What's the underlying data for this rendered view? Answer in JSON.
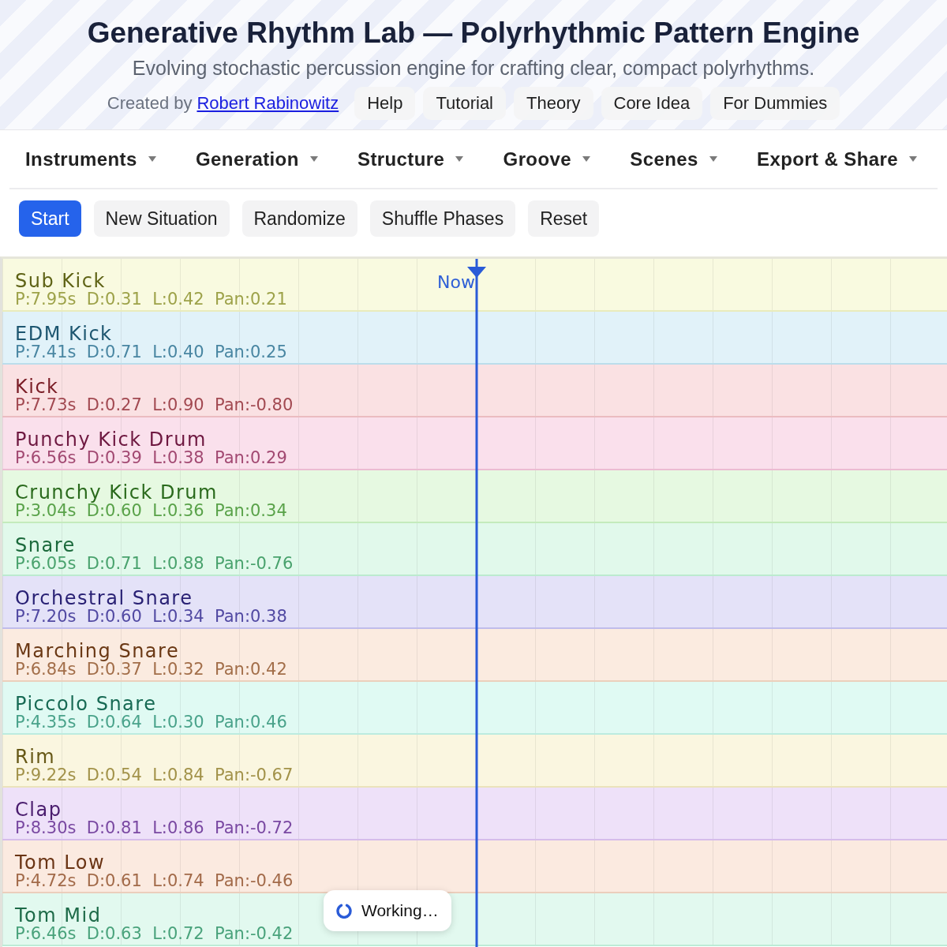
{
  "header": {
    "title": "Generative Rhythm Lab — Polyrhythmic Pattern Engine",
    "subtitle": "Evolving stochastic percussion engine for crafting clear, compact polyrhythms.",
    "credit": {
      "prefix": "Created by",
      "author": "Robert Rabinowitz"
    },
    "links": [
      "Help",
      "Tutorial",
      "Theory",
      "Core Idea",
      "For Dummies"
    ]
  },
  "menu": [
    "Instruments",
    "Generation",
    "Structure",
    "Groove",
    "Scenes",
    "Export & Share"
  ],
  "actions": [
    {
      "label": "Start",
      "kind": "primary"
    },
    {
      "label": "New Situation",
      "kind": "secondary"
    },
    {
      "label": "Randomize",
      "kind": "secondary"
    },
    {
      "label": "Shuffle Phases",
      "kind": "secondary"
    },
    {
      "label": "Reset",
      "kind": "secondary"
    }
  ],
  "timeline": {
    "playhead": {
      "label": "Now"
    },
    "tracks": [
      {
        "name": "Sub Kick",
        "params": "P:7.95s  D:0.31  L:0.42  Pan:0.21",
        "color": "#5f6316"
      },
      {
        "name": "EDM Kick",
        "params": "P:7.41s  D:0.71  L:0.40  Pan:0.25",
        "color": "#1d5670"
      },
      {
        "name": "Kick",
        "params": "P:7.73s  D:0.27  L:0.90  Pan:-0.80",
        "color": "#7a1d26"
      },
      {
        "name": "Punchy Kick Drum",
        "params": "P:6.56s  D:0.39  L:0.38  Pan:0.29",
        "color": "#6e1840"
      },
      {
        "name": "Crunchy Kick Drum",
        "params": "P:3.04s  D:0.60  L:0.36  Pan:0.34",
        "color": "#2a6a1c"
      },
      {
        "name": "Snare",
        "params": "P:6.05s  D:0.71  L:0.88  Pan:-0.76",
        "color": "#1c6a3c"
      },
      {
        "name": "Orchestral Snare",
        "params": "P:7.20s  D:0.60  L:0.34  Pan:0.38",
        "color": "#2a2275"
      },
      {
        "name": "Marching Snare",
        "params": "P:6.84s  D:0.37  L:0.32  Pan:0.42",
        "color": "#6a3814"
      },
      {
        "name": "Piccolo Snare",
        "params": "P:4.35s  D:0.64  L:0.30  Pan:0.46",
        "color": "#176a54"
      },
      {
        "name": "Rim",
        "params": "P:9.22s  D:0.54  L:0.84  Pan:-0.67",
        "color": "#665816"
      },
      {
        "name": "Clap",
        "params": "P:8.30s  D:0.81  L:0.86  Pan:-0.72",
        "color": "#4a1d6e"
      },
      {
        "name": "Tom Low",
        "params": "P:4.72s  D:0.61  L:0.74  Pan:-0.46",
        "color": "#6a3414"
      },
      {
        "name": "Tom Mid",
        "params": "P:6.46s  D:0.63  L:0.72  Pan:-0.42",
        "color": "#1d6a48"
      }
    ]
  },
  "status": {
    "text": "Working…"
  }
}
